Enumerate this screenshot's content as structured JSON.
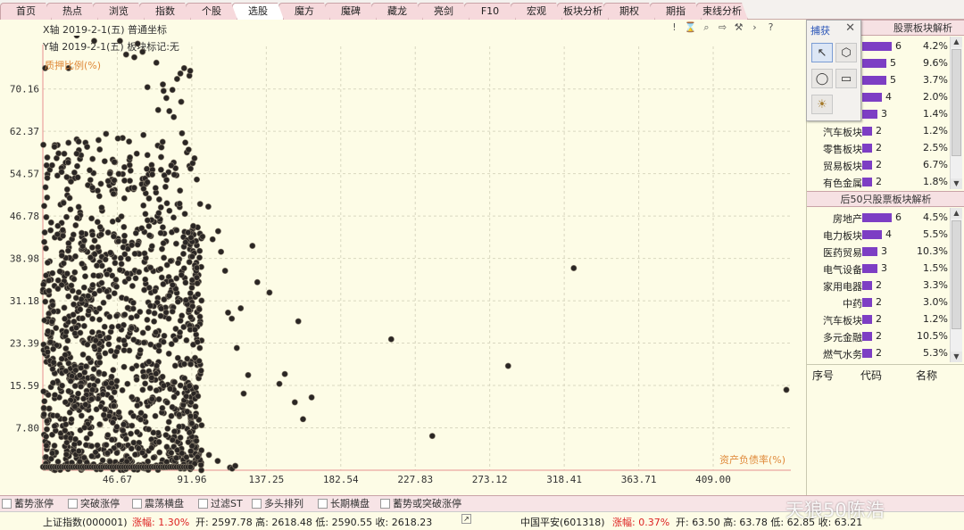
{
  "tabs": [
    {
      "label": "首页",
      "active": false
    },
    {
      "label": "热点",
      "active": false
    },
    {
      "label": "浏览",
      "active": false
    },
    {
      "label": "指数",
      "active": false
    },
    {
      "label": "个股",
      "active": false
    },
    {
      "label": "选股",
      "active": true
    },
    {
      "label": "魔方",
      "active": false
    },
    {
      "label": "魔碑",
      "active": false
    },
    {
      "label": "藏龙",
      "active": false
    },
    {
      "label": "亮剑",
      "active": false
    },
    {
      "label": "F10",
      "active": false
    },
    {
      "label": "宏观",
      "active": false
    },
    {
      "label": "板块分析",
      "active": false
    },
    {
      "label": "期权",
      "active": false
    },
    {
      "label": "期指",
      "active": false
    },
    {
      "label": "束线分析",
      "active": false
    }
  ],
  "info": {
    "x_line": "X轴  2019-2-1(五)  普通坐标",
    "y_line": "Y轴  2019-2-1(五)  板块标记:无"
  },
  "toolbar_icons": [
    "exclamation-icon",
    "hourglass-icon",
    "zoom-icon",
    "export-icon",
    "wrench-icon",
    "next-icon",
    "help-icon"
  ],
  "toolbar_glyphs": [
    "!",
    "⌛",
    "⌕",
    "⇨",
    "⚒",
    "›",
    "?"
  ],
  "capture": {
    "title": "捕获",
    "close": "✕",
    "tools": [
      {
        "name": "pointer-tool-icon",
        "glyph": "↖",
        "selected": true
      },
      {
        "name": "hexagon-tool-icon",
        "glyph": "⬡",
        "selected": false
      },
      {
        "name": "circle-tool-icon",
        "glyph": "◯",
        "selected": false
      },
      {
        "name": "rectangle-tool-icon",
        "glyph": "▭",
        "selected": false
      },
      {
        "name": "sun-tool-icon",
        "glyph": "☀",
        "selected": false
      }
    ]
  },
  "top_section": {
    "title": "股票板块解析",
    "rows": [
      {
        "name": "",
        "count": "6",
        "pct": "4.2%",
        "fill": 1.0
      },
      {
        "name": "",
        "count": "5",
        "pct": "9.6%",
        "fill": 0.83
      },
      {
        "name": "",
        "count": "5",
        "pct": "3.7%",
        "fill": 0.83
      },
      {
        "name": "",
        "count": "4",
        "pct": "2.0%",
        "fill": 0.67
      },
      {
        "name": "",
        "count": "3",
        "pct": "1.4%",
        "fill": 0.5
      },
      {
        "name": "汽车板块",
        "count": "2",
        "pct": "1.2%",
        "fill": 0.33
      },
      {
        "name": "零售板块",
        "count": "2",
        "pct": "2.5%",
        "fill": 0.33
      },
      {
        "name": "贸易板块",
        "count": "2",
        "pct": "6.7%",
        "fill": 0.33
      },
      {
        "name": "有色金属",
        "count": "2",
        "pct": "1.8%",
        "fill": 0.33
      }
    ]
  },
  "bottom_section": {
    "title": "后50只股票板块解析",
    "rows": [
      {
        "name": "房地产",
        "count": "6",
        "pct": "4.5%",
        "fill": 1.0
      },
      {
        "name": "电力板块",
        "count": "4",
        "pct": "5.5%",
        "fill": 0.67
      },
      {
        "name": "医药贸易",
        "count": "3",
        "pct": "10.3%",
        "fill": 0.5
      },
      {
        "name": "电气设备",
        "count": "3",
        "pct": "1.5%",
        "fill": 0.5
      },
      {
        "name": "家用电器",
        "count": "2",
        "pct": "3.3%",
        "fill": 0.33
      },
      {
        "name": "中药",
        "count": "2",
        "pct": "3.0%",
        "fill": 0.33
      },
      {
        "name": "汽车板块",
        "count": "2",
        "pct": "1.2%",
        "fill": 0.33
      },
      {
        "name": "多元金融",
        "count": "2",
        "pct": "10.5%",
        "fill": 0.33
      },
      {
        "name": "燃气水务",
        "count": "2",
        "pct": "5.3%",
        "fill": 0.33
      }
    ]
  },
  "table_header": {
    "seq": "序号",
    "code": "代码",
    "name": "名称"
  },
  "filters": [
    "蓄势涨停",
    "突破涨停",
    "震荡横盘",
    "过滤ST",
    "多头排列",
    "长期横盘",
    "蓄势或突破涨停"
  ],
  "status": {
    "left_name": "上证指数(000001)",
    "left_change": "涨幅: 1.30%",
    "left_ohlc": "开: 2597.78  高: 2618.48  低: 2590.55  收: 2618.23",
    "right_name": "中国平安(601318)",
    "right_change": "涨幅: 0.37%",
    "right_ohlc": "开: 63.50  高: 63.78  低: 62.85  收: 63.21"
  },
  "watermark": "天狼50陈浩",
  "colors": {
    "accent": "#e08a3a",
    "bar": "#7d3ec4",
    "tab": "#f6d9dc",
    "dot": "#2a2624"
  },
  "chart_data": {
    "type": "scatter",
    "ylabel": "质押比例(%)",
    "xlabel": "资产负债率(%)",
    "x_ticks": [
      "46.67",
      "91.96",
      "137.25",
      "182.54",
      "227.83",
      "273.12",
      "318.41",
      "363.71",
      "409.00"
    ],
    "y_ticks": [
      "70.16",
      "62.37",
      "54.57",
      "46.78",
      "38.98",
      "31.18",
      "23.39",
      "15.59",
      "7.80"
    ],
    "xlim": [
      1.38,
      456.2
    ],
    "ylim": [
      0,
      78
    ],
    "grid": true,
    "dense_cluster": {
      "x_range": [
        1.4,
        98
      ],
      "y_range": [
        0,
        62
      ],
      "count": 1400
    },
    "points": [
      [
        2.8,
        74
      ],
      [
        8.5,
        81
      ],
      [
        17,
        74
      ],
      [
        22,
        80
      ],
      [
        28.3,
        81
      ],
      [
        32.6,
        79
      ],
      [
        36.7,
        83
      ],
      [
        40,
        82
      ],
      [
        48.3,
        79
      ],
      [
        52,
        76.5
      ],
      [
        57,
        76
      ],
      [
        59,
        78.5
      ],
      [
        60.5,
        83
      ],
      [
        62,
        77
      ],
      [
        65,
        70.5
      ],
      [
        74.4,
        71
      ],
      [
        74.8,
        69.8
      ],
      [
        76.5,
        68.5
      ],
      [
        80.2,
        70
      ],
      [
        83,
        72
      ],
      [
        85,
        73
      ],
      [
        90.5,
        72.6
      ],
      [
        91,
        73.5
      ],
      [
        47.5,
        82
      ],
      [
        87.3,
        74
      ],
      [
        70.4,
        75
      ],
      [
        71.5,
        66.3
      ],
      [
        78.3,
        66.1
      ],
      [
        81,
        65
      ],
      [
        85.5,
        67.8
      ],
      [
        86,
        62
      ],
      [
        88,
        60.3
      ],
      [
        89,
        58.5
      ],
      [
        90,
        59
      ],
      [
        90.5,
        56
      ],
      [
        91.2,
        55.5
      ],
      [
        92.5,
        56.5
      ],
      [
        93.6,
        57.4
      ],
      [
        95,
        53.5
      ],
      [
        97,
        49
      ],
      [
        98.5,
        43
      ],
      [
        102,
        48.5
      ],
      [
        104.6,
        42.5
      ],
      [
        108,
        44
      ],
      [
        109.7,
        40.2
      ],
      [
        112.2,
        36.7
      ],
      [
        114,
        29
      ],
      [
        116.3,
        27.9
      ],
      [
        119.3,
        22.5
      ],
      [
        121.7,
        29.8
      ],
      [
        123.5,
        14.1
      ],
      [
        126.2,
        17.5
      ],
      [
        128.8,
        41.3
      ],
      [
        131.8,
        34.6
      ],
      [
        139.2,
        32.7
      ],
      [
        145.2,
        15.9
      ],
      [
        148.5,
        17.7
      ],
      [
        154.6,
        12.5
      ],
      [
        156.7,
        27.4
      ],
      [
        159.6,
        9.4
      ],
      [
        164.8,
        13.4
      ],
      [
        213.2,
        24.1
      ],
      [
        238.2,
        6.3
      ],
      [
        284.3,
        19.2
      ],
      [
        324.2,
        37.2
      ],
      [
        453.5,
        14.8
      ],
      [
        102.4,
        2.8
      ],
      [
        107.7,
        1.7
      ],
      [
        115.2,
        0.5
      ],
      [
        116.5,
        0.3
      ],
      [
        118.4,
        0.8
      ],
      [
        1.5,
        33.2
      ],
      [
        3.2,
        32.8
      ],
      [
        5.1,
        33.0
      ],
      [
        4.3,
        38.2
      ],
      [
        7.7,
        22.3
      ],
      [
        1.8,
        14.5
      ],
      [
        3.4,
        6.2
      ]
    ]
  }
}
